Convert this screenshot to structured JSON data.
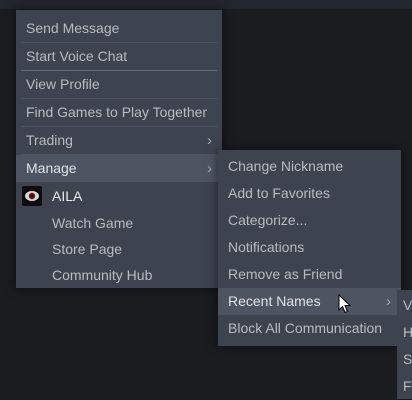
{
  "friend_menu": {
    "items": [
      {
        "label": "Send Message"
      },
      {
        "label": "Start Voice Chat"
      },
      {
        "label": "View Profile"
      },
      {
        "label": "Find Games to Play Together"
      },
      {
        "label": "Trading"
      },
      {
        "label": "Manage"
      }
    ],
    "game": {
      "title": "AILA",
      "actions": [
        {
          "label": "Watch Game"
        },
        {
          "label": "Store Page"
        },
        {
          "label": "Community Hub"
        }
      ]
    }
  },
  "manage_menu": {
    "items": [
      {
        "label": "Change Nickname"
      },
      {
        "label": "Add to Favorites"
      },
      {
        "label": "Categorize..."
      },
      {
        "label": "Notifications"
      },
      {
        "label": "Remove as Friend"
      },
      {
        "label": "Recent Names"
      },
      {
        "label": "Block All Communication"
      }
    ]
  },
  "recent_names_menu": {
    "visible_initials": [
      "V",
      "H",
      "S",
      "F"
    ]
  },
  "icons": {
    "submenu_arrow": "chevron-right-icon",
    "game": "game-icon",
    "cursor": "mouse-pointer-icon"
  },
  "colors": {
    "background": "#1b1c20",
    "menu": "#3d4450",
    "highlight": "#4e5562",
    "text": "#b8bcbf"
  }
}
